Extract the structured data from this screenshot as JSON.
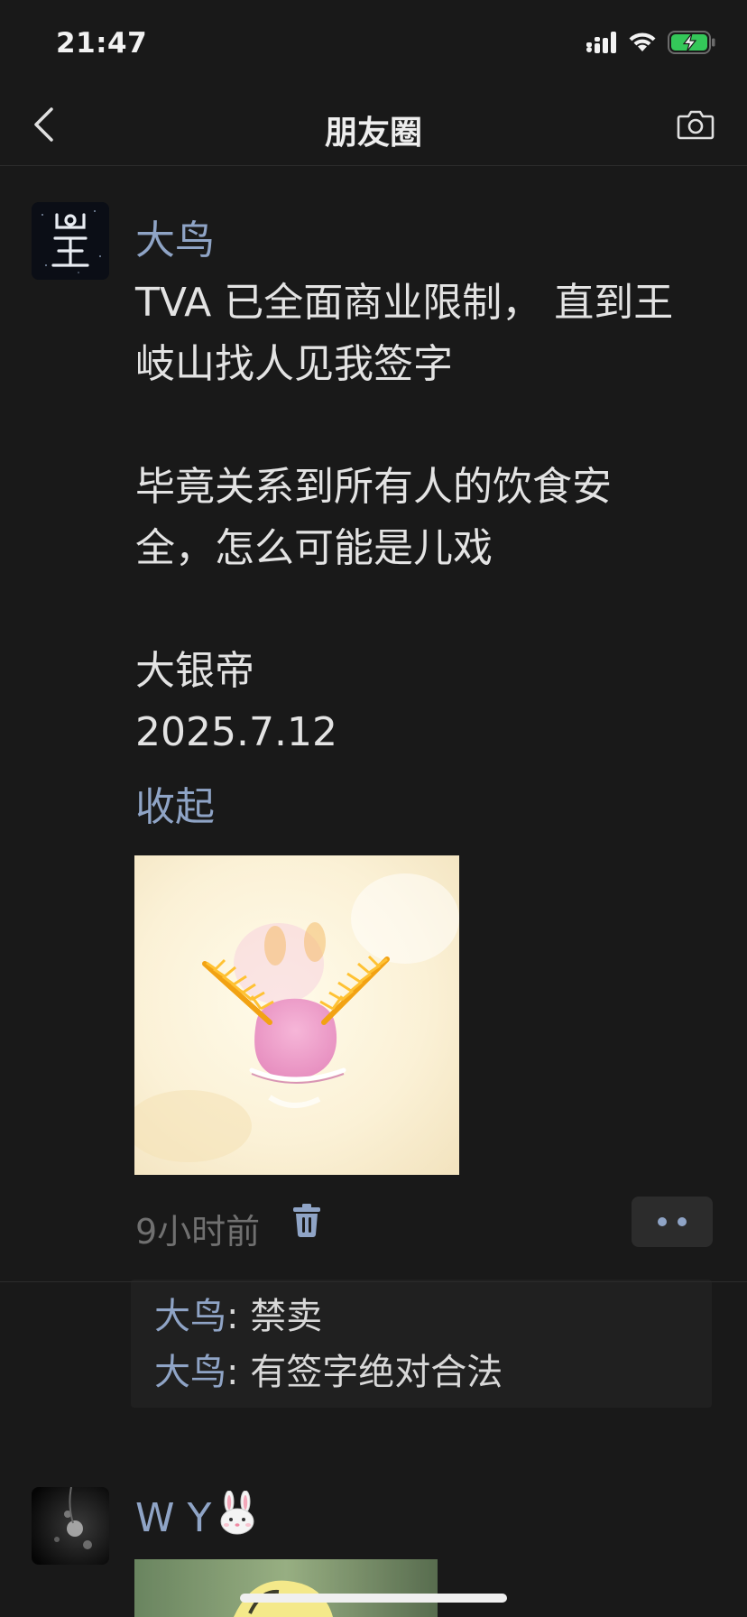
{
  "status_bar": {
    "time": "21:47",
    "icons": [
      "signal-icon",
      "wifi-icon",
      "battery-charging-icon"
    ],
    "battery_color": "#34c759"
  },
  "nav": {
    "title": "朋友圈",
    "left_icon": "chevron-left-icon",
    "right_icon": "camera-icon"
  },
  "post": {
    "author": "大鸟",
    "lines": [
      "TVA 已全面商业限制， 直到王",
      "岐山找人见我签字",
      "毕竟关系到所有人的饮食安",
      "全，怎么可能是儿戏",
      "大银帝",
      "2025.7.12"
    ],
    "collapse": "收起",
    "time": "9小时前",
    "comments": [
      {
        "author": "大鸟",
        "sep": ": ",
        "text": "禁卖"
      },
      {
        "author": "大鸟",
        "sep": ": ",
        "text": "有签字绝对合法"
      }
    ]
  },
  "next_post": {
    "author": "W Y",
    "author_emoji_icon": "rabbit-face-icon"
  },
  "colors": {
    "background": "#191919",
    "link": "#8fa4c6",
    "text": "#e3e3e3",
    "muted": "#707070",
    "comment_bg": "#202020"
  }
}
